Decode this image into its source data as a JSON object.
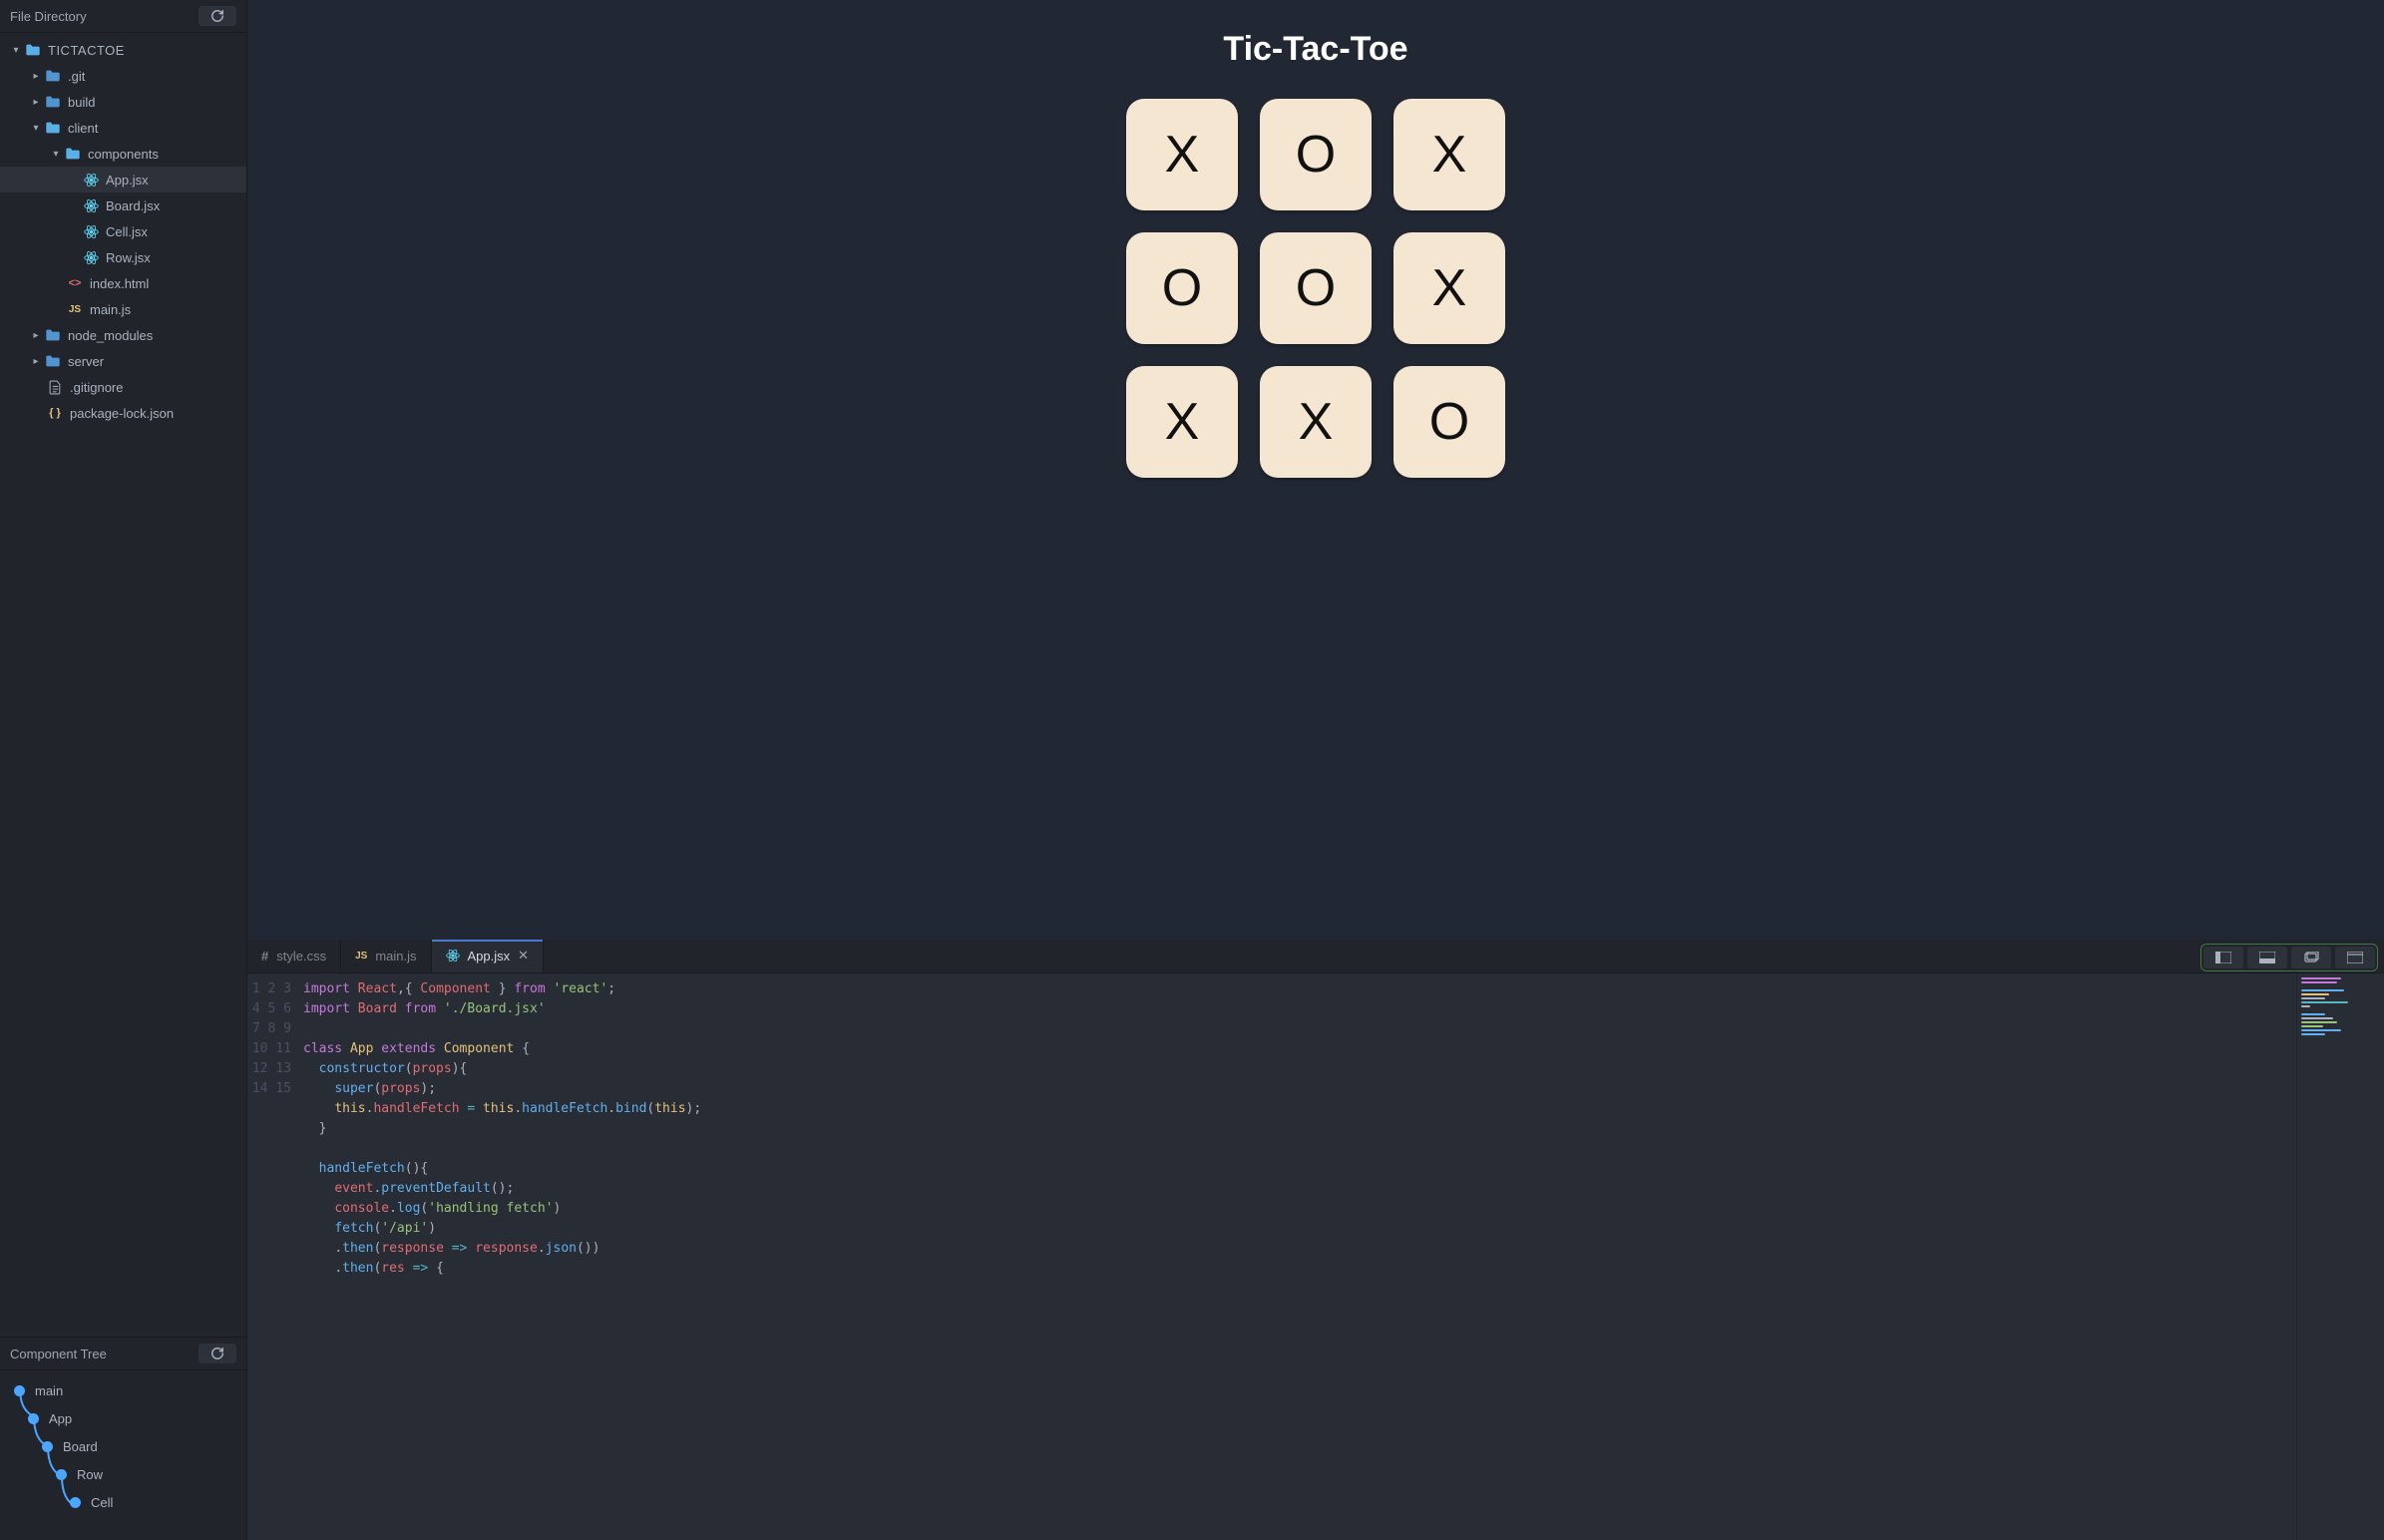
{
  "sidebar": {
    "file_directory_label": "File Directory",
    "component_tree_label": "Component Tree",
    "root": "TICTACTOE",
    "tree": {
      "git": ".git",
      "build": "build",
      "client": "client",
      "components": "components",
      "app_jsx": "App.jsx",
      "board_jsx": "Board.jsx",
      "cell_jsx": "Cell.jsx",
      "row_jsx": "Row.jsx",
      "index_html": "index.html",
      "main_js": "main.js",
      "node_modules": "node_modules",
      "server": "server",
      "gitignore": ".gitignore",
      "package_lock": "package-lock.json"
    },
    "component_tree": {
      "main": "main",
      "app": "App",
      "board": "Board",
      "row": "Row",
      "cell": "Cell"
    }
  },
  "preview": {
    "title": "Tic-Tac-Toe",
    "cells": [
      "X",
      "O",
      "X",
      "O",
      "O",
      "X",
      "X",
      "X",
      "O"
    ]
  },
  "tabs": {
    "style_css": "style.css",
    "main_js": "main.js",
    "app_jsx": "App.jsx"
  },
  "editor": {
    "line_count": 15,
    "code_html": "<span class='kw'>import</span> <span class='id'>React</span><span class='pun'>,{ </span><span class='id'>Component</span><span class='pun'> }</span> <span class='kw'>from</span> <span class='str'>'react'</span><span class='pun'>;</span>\n<span class='kw'>import</span> <span class='id'>Board</span> <span class='kw'>from</span> <span class='str'>'./Board.jsx'</span>\n\n<span class='kw'>class</span> <span class='cls'>App</span> <span class='kw'>extends</span> <span class='cls'>Component</span> <span class='pun'>{</span>\n  <span class='fn'>constructor</span><span class='pun'>(</span><span class='id'>props</span><span class='pun'>){</span>\n    <span class='fn'>super</span><span class='pun'>(</span><span class='id'>props</span><span class='pun'>);</span>\n    <span class='this'>this</span><span class='pun'>.</span><span class='prop'>handleFetch</span> <span class='op'>=</span> <span class='this'>this</span><span class='pun'>.</span><span class='fn'>handleFetch</span><span class='pun'>.</span><span class='fn'>bind</span><span class='pun'>(</span><span class='this'>this</span><span class='pun'>);</span>\n  <span class='pun'>}</span>\n\n  <span class='fn'>handleFetch</span><span class='pun'>(){</span>\n    <span class='id'>event</span><span class='pun'>.</span><span class='fn'>preventDefault</span><span class='pun'>();</span>\n    <span class='id'>console</span><span class='pun'>.</span><span class='fn'>log</span><span class='pun'>(</span><span class='str'>'handling fetch'</span><span class='pun'>)</span>\n    <span class='fn'>fetch</span><span class='pun'>(</span><span class='str'>'/api'</span><span class='pun'>)</span>\n    <span class='pun'>.</span><span class='fn'>then</span><span class='pun'>(</span><span class='id'>response</span> <span class='op'>=&gt;</span> <span class='id'>response</span><span class='pun'>.</span><span class='fn'>json</span><span class='pun'>())</span>\n    <span class='pun'>.</span><span class='fn'>then</span><span class='pun'>(</span><span class='id'>res</span> <span class='op'>=&gt;</span> <span class='pun'>{</span>"
  }
}
